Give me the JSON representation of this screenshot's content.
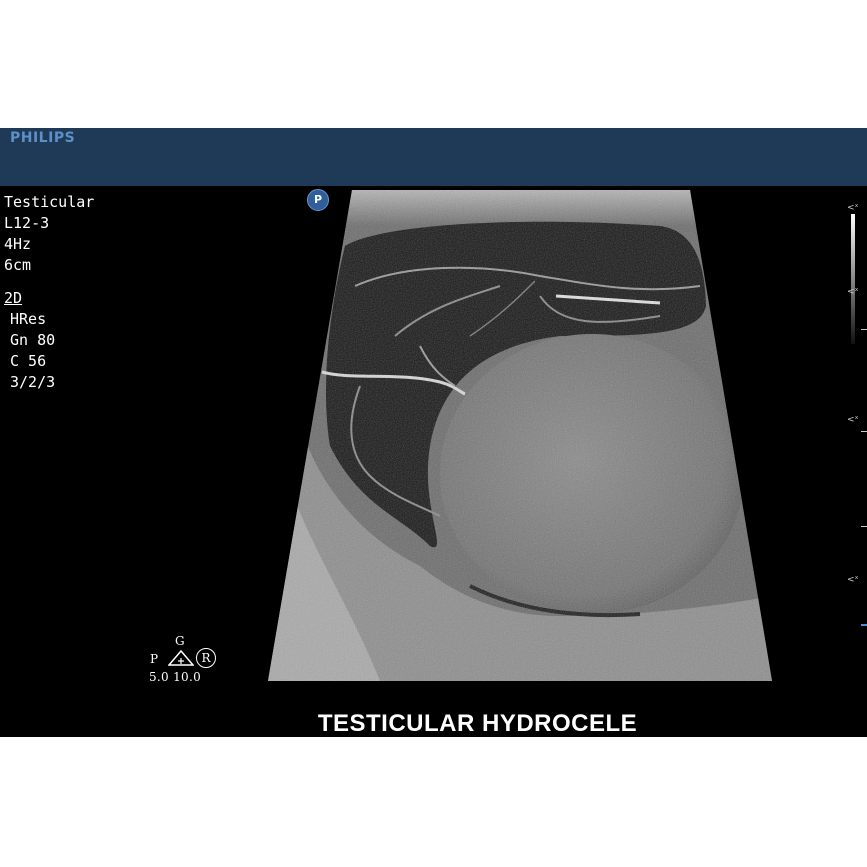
{
  "header": {
    "brand": "PHILIPS"
  },
  "settings": {
    "preset": "Testicular",
    "probe": "L12-3",
    "frequency": "4Hz",
    "depth": "6cm",
    "mode": "2D",
    "resolution": "HRes",
    "gain": "Gn 80",
    "compression": "C 56",
    "persistence": "3/2/3"
  },
  "marker": {
    "label": "P"
  },
  "orientation": {
    "g_label": "G",
    "p_label": "P",
    "r_label": "R",
    "values": "5.0  10.0"
  },
  "caption": "TESTICULAR  HYDROCELE",
  "colors": {
    "header": "#1f3a57",
    "brand": "#5d8fc8",
    "background": "#000000"
  }
}
